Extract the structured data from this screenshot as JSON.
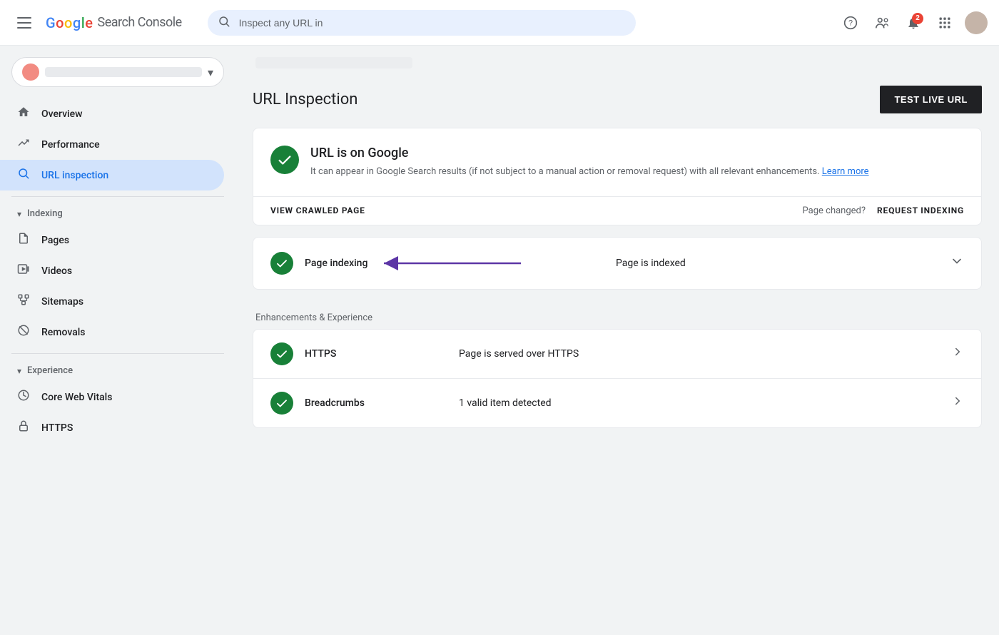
{
  "topbar": {
    "logo_google": "Google",
    "logo_product": "Search Console",
    "search_placeholder": "Inspect any URL in",
    "help_icon": "?",
    "account_icon": "👤",
    "notification_count": "2",
    "apps_icon": "⋮"
  },
  "sidebar": {
    "property_name_placeholder": "",
    "nav_items": [
      {
        "id": "overview",
        "label": "Overview",
        "icon": "🏠"
      },
      {
        "id": "performance",
        "label": "Performance",
        "icon": "↗"
      },
      {
        "id": "url-inspection",
        "label": "URL inspection",
        "icon": "🔍",
        "active": true
      }
    ],
    "indexing_section": {
      "label": "Indexing",
      "items": [
        {
          "id": "pages",
          "label": "Pages",
          "icon": "📄"
        },
        {
          "id": "videos",
          "label": "Videos",
          "icon": "🎬"
        },
        {
          "id": "sitemaps",
          "label": "Sitemaps",
          "icon": "🗂"
        },
        {
          "id": "removals",
          "label": "Removals",
          "icon": "🚫"
        }
      ]
    },
    "experience_section": {
      "label": "Experience",
      "items": [
        {
          "id": "core-web-vitals",
          "label": "Core Web Vitals",
          "icon": "⏱"
        },
        {
          "id": "https",
          "label": "HTTPS",
          "icon": "🔒"
        }
      ]
    }
  },
  "main": {
    "url_text": "",
    "page_title": "URL Inspection",
    "test_live_url_btn": "TEST LIVE URL",
    "status_card": {
      "title": "URL is on Google",
      "description": "It can appear in Google Search results (if not subject to a manual action or removal request) with all relevant enhancements.",
      "learn_more_text": "Learn more",
      "view_crawled_page": "VIEW CRAWLED PAGE",
      "page_changed_label": "Page changed?",
      "request_indexing": "REQUEST INDEXING"
    },
    "page_indexing_row": {
      "label": "Page indexing",
      "status": "Page is indexed"
    },
    "enhancements_section": {
      "header": "Enhancements & Experience",
      "items": [
        {
          "id": "https",
          "label": "HTTPS",
          "status": "Page is served over HTTPS"
        },
        {
          "id": "breadcrumbs",
          "label": "Breadcrumbs",
          "status": "1 valid item detected"
        }
      ]
    }
  }
}
